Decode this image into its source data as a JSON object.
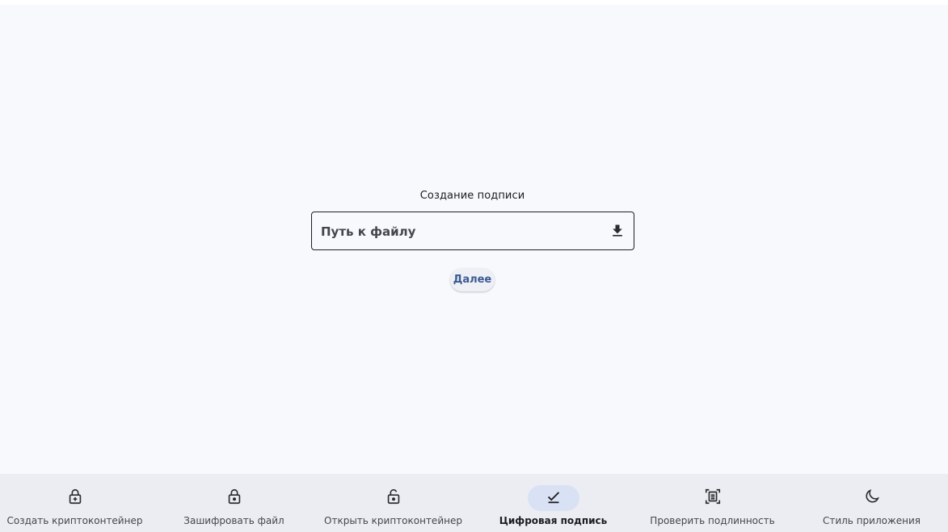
{
  "main": {
    "section_title": "Создание подписи",
    "file_path_placeholder": "Путь к файлу",
    "next_label": "Далее"
  },
  "nav": {
    "items": [
      {
        "label": "Создать криптоконтейнер",
        "icon": "lock-plus-icon"
      },
      {
        "label": "Зашифровать файл",
        "icon": "lock-icon"
      },
      {
        "label": "Открыть криптоконтейнер",
        "icon": "lock-open-icon"
      },
      {
        "label": "Цифровая подпись",
        "icon": "check-icon",
        "active": true
      },
      {
        "label": "Проверить подлинность",
        "icon": "document-scan-icon"
      },
      {
        "label": "Стиль приложения",
        "icon": "moon-icon"
      }
    ]
  },
  "colors": {
    "background": "#f7f9fd",
    "navbar": "#ecedf2",
    "active_indicator": "#d9e2f4",
    "accent_text": "#3b5a92"
  }
}
